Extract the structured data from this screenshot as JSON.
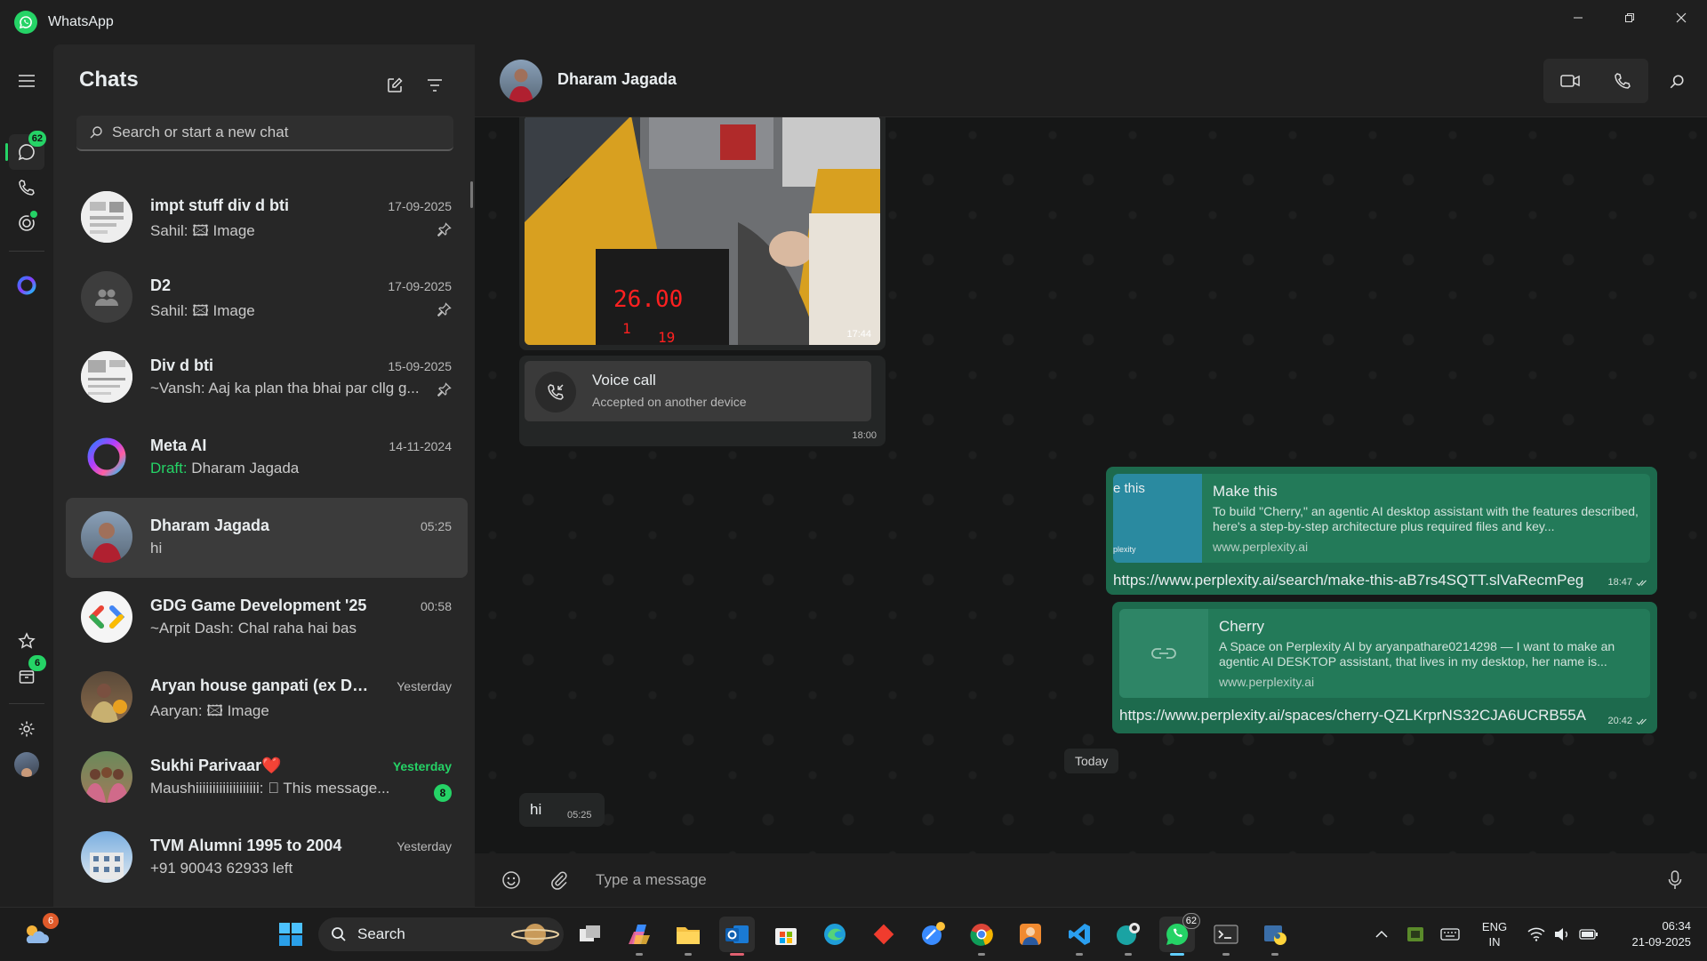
{
  "app": {
    "title": "WhatsApp"
  },
  "rail": {
    "chats_badge": "62",
    "archive_badge": "6"
  },
  "chatlist": {
    "title": "Chats",
    "search_placeholder": "Search or start a new chat",
    "items": [
      {
        "name": "impt stuff div d bti",
        "time": "17-09-2025",
        "sender": "Sahil:",
        "preview": "Image",
        "pinned": true
      },
      {
        "name": "D2",
        "time": "17-09-2025",
        "sender": "Sahil:",
        "preview": "Image",
        "pinned": true
      },
      {
        "name": "Div d bti",
        "time": "15-09-2025",
        "preview": "~Vansh: Aaj ka plan tha bhai par cllg g...",
        "pinned": true
      },
      {
        "name": "Meta AI",
        "time": "14-11-2024",
        "draft_label": "Draft:",
        "preview": "Dharam Jagada"
      },
      {
        "name": "Dharam Jagada",
        "time": "05:25",
        "preview": "hi"
      },
      {
        "name": "GDG Game Development '25",
        "time": "00:58",
        "preview": "~Arpit Dash: Chal raha hai bas"
      },
      {
        "name": "Aryan house ganpati (ex Dea...",
        "time": "Yesterday",
        "sender": "Aaryan:",
        "preview": "Image"
      },
      {
        "name": "Sukhi Parivaar❤️",
        "time": "Yesterday",
        "preview": "Maushiiiiiiiiiiiiiiiiiii: ⃠ This message...",
        "unread": "8"
      },
      {
        "name": "TVM Alumni 1995 to 2004",
        "time": "Yesterday",
        "preview": "+91 90043 62933 left"
      }
    ]
  },
  "conversation": {
    "contact_name": "Dharam Jagada",
    "image_message": {
      "time": "17:44",
      "meter_text": "26.00",
      "meter_sub1": "1",
      "meter_sub2": "19"
    },
    "call_message": {
      "title": "Voice call",
      "subtitle": "Accepted on another device",
      "time": "18:00"
    },
    "link_message_1": {
      "thumb_text": "e this",
      "thumb_brand": "plexity",
      "title": "Make this",
      "description": "To build \"Cherry,\" an agentic AI desktop assistant with the features described, here's a step-by-step architecture plus required files and key...",
      "domain": "www.perplexity.ai",
      "url": "https://www.perplexity.ai/search/make-this-aB7rs4SQTT.slVaRecmPeg",
      "time": "18:47"
    },
    "link_message_2": {
      "title": "Cherry",
      "description": "A Space on Perplexity AI by aryanpathare0214298 — I want to make an agentic AI DESKTOP assistant, that lives in my desktop, her name is...",
      "domain": "www.perplexity.ai",
      "url": "https://www.perplexity.ai/spaces/cherry-QZLKrprNS32CJA6UCRB55A",
      "time": "20:42"
    },
    "day_divider": "Today",
    "text_message": {
      "text": "hi",
      "time": "05:25"
    },
    "composer_placeholder": "Type a message"
  },
  "taskbar": {
    "weather_badge": "6",
    "search_label": "Search",
    "whatsapp_badge": "62",
    "lang_line1": "ENG",
    "lang_line2": "IN",
    "time": "06:34",
    "date": "21-09-2025"
  }
}
